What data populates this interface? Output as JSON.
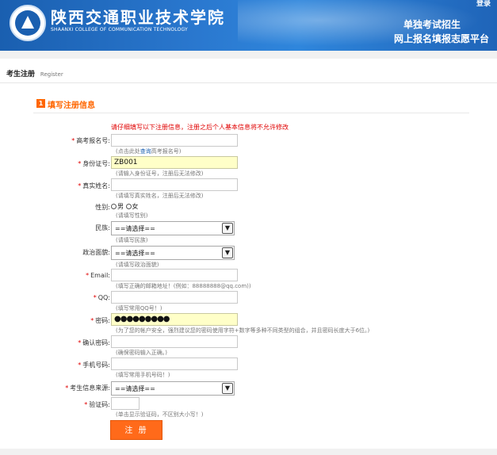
{
  "header": {
    "school_cn": "陕西交通职业技术学院",
    "school_en": "SHAANXI COLLEGE OF COMMUNICATION TECHNOLOGY",
    "login": "登录",
    "platform_line1": "单独考试招生",
    "platform_line2": "网上报名填报志愿平台"
  },
  "page": {
    "title": "考生注册",
    "subtitle": "Register"
  },
  "section": {
    "number": "1",
    "title": "填写注册信息"
  },
  "warning": "请仔细填写以下注册信息，注册之后个人基本信息将不允许修改",
  "form": {
    "exam_no": {
      "label": "高考报名号:",
      "value": "",
      "hint_prefix": "(点击此处",
      "hint_link": "查询",
      "hint_suffix": "高考报名号)"
    },
    "id_no": {
      "label": "身份证号:",
      "value": "ZB001",
      "hint": "(请输入身份证号，注册后无法修改)"
    },
    "real_name": {
      "label": "真实姓名:",
      "value": "",
      "hint": "(请填写真实姓名，注册后无法修改)"
    },
    "gender": {
      "label": "性别:",
      "option_male": "男",
      "option_female": "女",
      "hint": "(请填写性别)"
    },
    "ethnicity": {
      "label": "民族:",
      "selected": "==请选择==",
      "hint": "(请填写民族)"
    },
    "political": {
      "label": "政治面貌:",
      "selected": "==请选择==",
      "hint": "(请填写政治面貌)"
    },
    "email": {
      "label": "Email:",
      "value": "",
      "hint": "(填写正确的邮箱地址！(例如：88888888@qq.com))"
    },
    "qq": {
      "label": "QQ:",
      "value": "",
      "hint": "(填写常用QQ号！)"
    },
    "password": {
      "label": "密码:",
      "value": "●●●●●●●●●",
      "hint": "(为了您的帐户安全，强烈建议您的密码使用字符+数字等多种不同类型的组合，并且密码长度大于6位。)"
    },
    "confirm_password": {
      "label": "确认密码:",
      "value": "",
      "hint": "(确保密码输入正确。)"
    },
    "phone": {
      "label": "手机号码:",
      "value": "",
      "hint": "(填写常用手机号码！)"
    },
    "source": {
      "label": "考生信息来源:",
      "selected": "==请选择=="
    },
    "captcha": {
      "label": "验证码:",
      "value": "",
      "hint": "(单击显示验证码，不区别大小写！)"
    },
    "submit_label": "注 册"
  }
}
